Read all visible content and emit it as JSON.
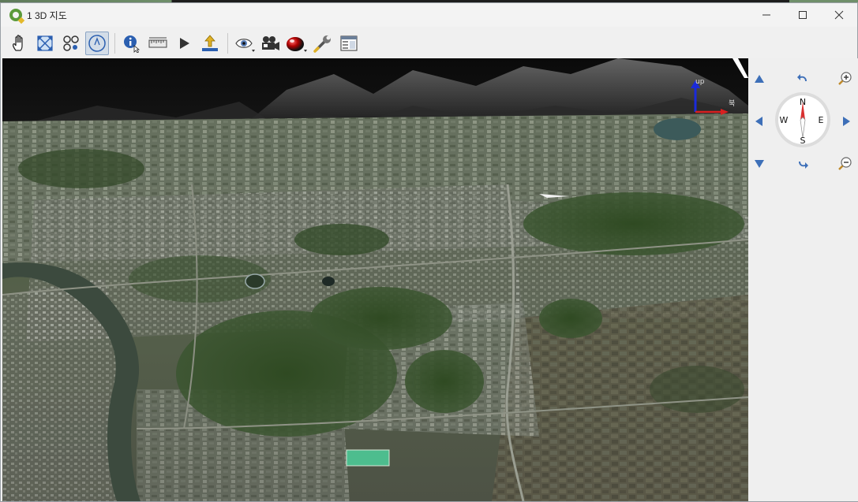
{
  "window": {
    "title": "1 3D 지도",
    "controls": {
      "minimize": "—",
      "maximize": "☐",
      "close": "✕"
    }
  },
  "toolbar": {
    "items": [
      {
        "icon": "pan-hand-icon"
      },
      {
        "icon": "zoom-full-icon"
      },
      {
        "icon": "camera-pose-icon"
      },
      {
        "icon": "navigation-compass-icon",
        "active": true
      },
      {
        "icon": "identify-icon"
      },
      {
        "icon": "measure-ruler-icon"
      },
      {
        "icon": "animation-play-icon"
      },
      {
        "icon": "export-icon"
      },
      {
        "icon": "visibility-eye-icon"
      },
      {
        "icon": "camera-video-icon"
      },
      {
        "icon": "shading-sphere-icon"
      },
      {
        "icon": "configure-wrench-icon"
      },
      {
        "icon": "scene-panel-icon"
      }
    ]
  },
  "axis_gizmo": {
    "up_label": "up",
    "north_label": "북"
  },
  "navigation": {
    "compass": {
      "north": "N",
      "south": "S",
      "east": "E",
      "west": "W"
    },
    "buttons": [
      "move-up",
      "rotate-ccw",
      "zoom-in",
      "move-left",
      "move-right",
      "move-down",
      "rotate-cw",
      "zoom-out"
    ]
  },
  "colors": {
    "accent_blue": "#2b5fb0",
    "compass_red": "#d93030",
    "nav_arrow": "#3d6fb8"
  }
}
